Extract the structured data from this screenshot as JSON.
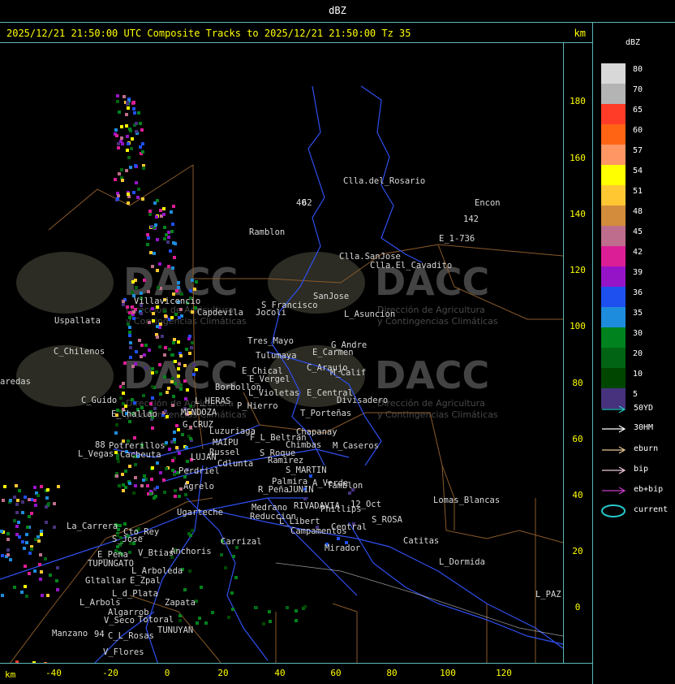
{
  "window": {
    "title": "dBZ"
  },
  "header": {
    "title": "2025/12/21 21:50:00 UTC Composite Tracks to 2025/12/21 21:50:00 Tz 35",
    "unit": "km"
  },
  "axes": {
    "x_unit": "km",
    "y_ticks": [
      "180",
      "160",
      "140",
      "120",
      "100",
      "80",
      "60",
      "40",
      "20",
      "0"
    ],
    "x_ticks": [
      "-40",
      "-20",
      "0",
      "20",
      "40",
      "60",
      "80",
      "100",
      "120"
    ]
  },
  "legend": {
    "title": "dBZ",
    "scale": [
      {
        "label": "80",
        "color": "#d8d8d8"
      },
      {
        "label": "70",
        "color": "#b4b4b4"
      },
      {
        "label": "65",
        "color": "#ff3c28"
      },
      {
        "label": "60",
        "color": "#ff6414"
      },
      {
        "label": "57",
        "color": "#ff9664"
      },
      {
        "label": "54",
        "color": "#ffff00"
      },
      {
        "label": "51",
        "color": "#ffc832"
      },
      {
        "label": "48",
        "color": "#d28c3c"
      },
      {
        "label": "45",
        "color": "#be6e8c"
      },
      {
        "label": "42",
        "color": "#dc1e96"
      },
      {
        "label": "39",
        "color": "#9614c8"
      },
      {
        "label": "36",
        "color": "#1e50f0"
      },
      {
        "label": "35",
        "color": "#1e8cdc"
      },
      {
        "label": "30",
        "color": "#00821e"
      },
      {
        "label": "20",
        "color": "#006414"
      },
      {
        "label": "10",
        "color": "#004600"
      },
      {
        "label": "5",
        "color": "#46327d"
      }
    ],
    "tracks": [
      {
        "label": "50YD",
        "color": "#28c8c8"
      },
      {
        "label": "30HM",
        "color": "#ffffff"
      },
      {
        "label": "eburn",
        "color": "#e6c896"
      },
      {
        "label": "bip",
        "color": "#f0c8dc"
      },
      {
        "label": "eb+bip",
        "color": "#c83cc8"
      },
      {
        "label": "current",
        "color": "#28c8c8"
      }
    ]
  },
  "watermark": {
    "brand": "DACC",
    "line1": "Dirección de Agricultura",
    "line2": "y Contingencias Climáticas"
  },
  "places": [
    "Clla.del_Rosario",
    "Encon",
    "142",
    "E_1-736",
    "Ramblon",
    "40",
    "Clla.SanJose",
    "Clla.El_Cavadito",
    "Villavicencio",
    "Capdevila",
    "S_Francisco",
    "SanJose",
    "L_Asuncion",
    "Uspallata",
    "Jocoli",
    "Tres_Mayo",
    "G_Andre",
    "E_Carmen",
    "Tulumaya",
    "C_Chilenos",
    "C_Araujo",
    "M_Calif",
    "E_Chical",
    "E_Vergel",
    "Borbollon",
    "L_Violetas",
    "E_Central",
    "Divisadero",
    "aredas",
    "C_Guido",
    "L_HERAS",
    "P_Hierro",
    "T_Porteñas",
    "E_Challao",
    "MENDOZA",
    "G_CRUZ",
    "Luzuriaga",
    "Chapanay",
    "F_L_Beltran",
    "MAIPU",
    "Chimbas",
    "M_Caseros",
    "Potrerillos",
    "L_Vegas",
    "Cacheuta",
    "Russel",
    "S_Roque",
    "LUJAN",
    "Cdlunta",
    "Perdriel",
    "Ramirez",
    "S_MARTIN",
    "Agrelo",
    "A_Verde",
    "Palmira",
    "Tamblon",
    "R_Peña",
    "JUNIN",
    "Ugarteche",
    "Medrano",
    "RIVADAVIA",
    "Phillips",
    "12_Oct",
    "Lomas_Blancas",
    "Reduccion",
    "L_Libert",
    "S_ROSA",
    "La_Carrera",
    "Cto_Rey",
    "S_Jose",
    "Campamentos",
    "Central",
    "Carrizal",
    "Catitas",
    "E_Pena",
    "V_Btias",
    "Anchoris",
    "TUPUNGATO",
    "Mirador",
    "L_Arboleda",
    "L_Dormida",
    "Gltallar",
    "E_Zpal",
    "L_d_Plata",
    "L_PAZ",
    "L_Arbols",
    "Zapata",
    "Algarrob",
    "V_Seco",
    "Totoral",
    "TUNUYAN",
    "Manzano",
    "C_L_Rosas",
    "V_Flores",
    "94",
    "88",
    "62"
  ]
}
